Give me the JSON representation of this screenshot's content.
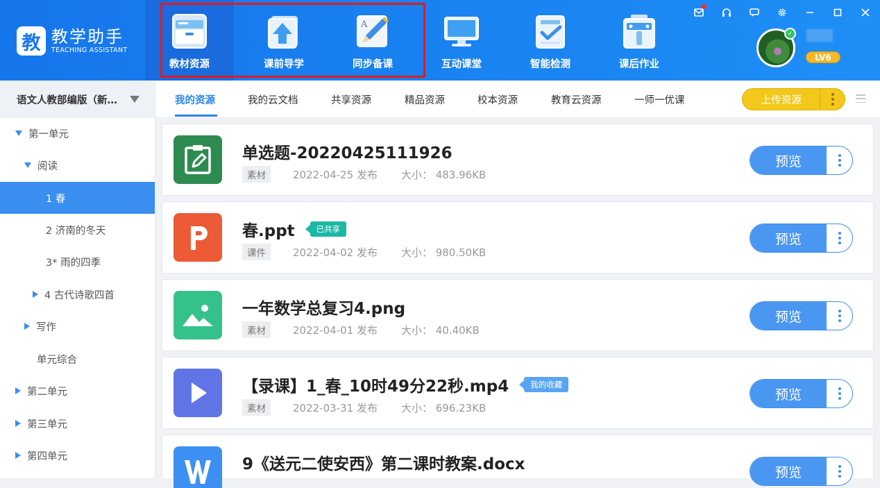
{
  "app": {
    "logo_char": "教",
    "name_cn": "教学助手",
    "name_en": "TEACHING ASSISTANT"
  },
  "nav": [
    {
      "label": "教材资源",
      "icon": "textbook-resource-icon"
    },
    {
      "label": "课前导学",
      "icon": "preclass-guide-icon"
    },
    {
      "label": "同步备课",
      "icon": "lesson-prep-icon"
    },
    {
      "label": "互动课堂",
      "icon": "interactive-class-icon"
    },
    {
      "label": "智能检测",
      "icon": "smart-test-icon"
    },
    {
      "label": "课后作业",
      "icon": "homework-icon"
    }
  ],
  "window_controls": [
    "mail-icon",
    "headset-icon",
    "chat-icon",
    "settings-icon",
    "minimize-icon",
    "maximize-icon",
    "close-icon"
  ],
  "user": {
    "level": "LV6"
  },
  "book": {
    "label": "语文人教部编版（新…"
  },
  "tree": [
    {
      "label": "第一单元",
      "expand": "down"
    },
    {
      "label": "阅读",
      "expand": "down"
    },
    {
      "label": "1 春",
      "selected": true
    },
    {
      "label": "2 济南的冬天"
    },
    {
      "label": "3* 雨的四季"
    },
    {
      "label": "4 古代诗歌四首",
      "expand": "right"
    },
    {
      "label": "写作",
      "expand": "right"
    },
    {
      "label": "单元综合"
    },
    {
      "label": "第二单元",
      "expand": "right"
    },
    {
      "label": "第三单元",
      "expand": "right"
    },
    {
      "label": "第四单元",
      "expand": "right"
    }
  ],
  "tabs": [
    "我的资源",
    "我的云文档",
    "共享资源",
    "精品资源",
    "校本资源",
    "教育云资源",
    "一师一优课"
  ],
  "upload_label": "上传资源",
  "preview_label": "预览",
  "files": [
    {
      "title": "单选题-20220425111926",
      "tag": "素材",
      "date": "2022-04-25 发布",
      "size": "大小： 483.96KB",
      "type": "quiz",
      "color": "#2e8b4f"
    },
    {
      "title": "春.ppt",
      "badge": "已共享",
      "tag": "课件",
      "date": "2022-04-02 发布",
      "size": "大小： 980.50KB",
      "type": "ppt",
      "color": "#ec5a36"
    },
    {
      "title": "一年数学总复习4.png",
      "tag": "素材",
      "date": "2022-04-01 发布",
      "size": "大小： 40.40KB",
      "type": "image",
      "color": "#35c28a"
    },
    {
      "title": "【录课】1_春_10时49分22秒.mp4",
      "badge": "我的收藏",
      "tag": "素材",
      "date": "2022-03-31 发布",
      "size": "大小： 696.23KB",
      "type": "video",
      "color": "#6275e6"
    },
    {
      "title": "9《送元二使安西》第二课时教案.docx",
      "type": "word",
      "color": "#3d8ff2"
    }
  ]
}
